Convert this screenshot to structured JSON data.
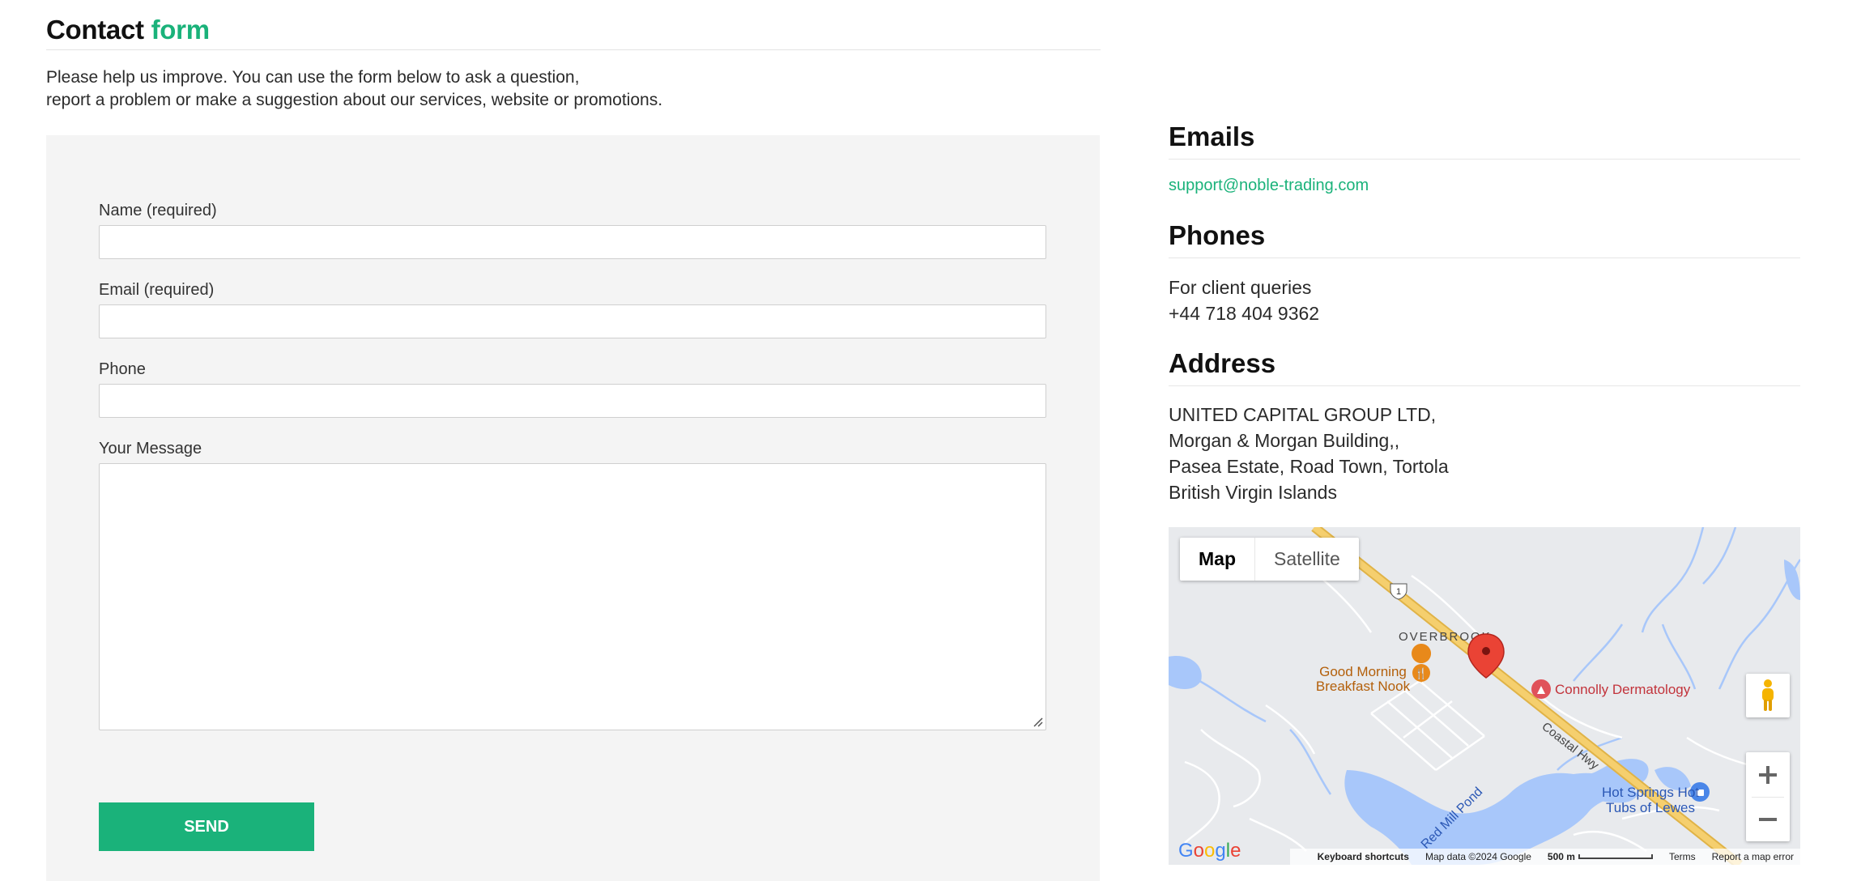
{
  "form": {
    "title_main": "Contact",
    "title_accent": "form",
    "intro_line1": "Please help us improve. You can use the form below to ask a question,",
    "intro_line2": "report a problem or make a suggestion about our services, website or promotions.",
    "name_label": "Name (required)",
    "name_value": "",
    "email_label": "Email (required)",
    "email_value": "",
    "phone_label": "Phone",
    "phone_value": "",
    "message_label": "Your Message",
    "message_value": "",
    "send_label": "SEND"
  },
  "contact": {
    "emails_heading": "Emails",
    "email": "support@noble-trading.com",
    "phones_heading": "Phones",
    "phone_caption": "For client queries",
    "phone_number": "+44 718 404 9362",
    "address_heading": "Address",
    "address_lines": [
      "UNITED CAPITAL GROUP LTD,",
      "Morgan & Morgan Building,,",
      "Pasea Estate, Road Town, Tortola",
      "British Virgin Islands"
    ]
  },
  "map": {
    "type_map": "Map",
    "type_satellite": "Satellite",
    "active_type": "Map",
    "place_overbrook": "OVERBROOK",
    "place_breakfast_1": "Good Morning",
    "place_breakfast_2": "Breakfast Nook",
    "place_derm": "Connolly Dermatology",
    "place_hot_1": "Hot Springs Hot",
    "place_hot_2": "Tubs of Lewes",
    "road_coastal": "Coastal Hwy",
    "road_redmill": "Red Mill Pond",
    "route_shield": "1",
    "logo": "Google",
    "keyboard_shortcuts": "Keyboard shortcuts",
    "map_data": "Map data ©2024 Google",
    "scale": "500 m",
    "terms": "Terms",
    "report": "Report a map error",
    "colors": {
      "water": "#a8c7fa",
      "land": "#e8eaed",
      "road": "#f5cf6e",
      "road_edge": "#e0b347",
      "pin": "#ea4335",
      "poi_food": "#e8891a",
      "poi_red": "#e0525a",
      "poi_blue": "#4a86e8"
    }
  }
}
